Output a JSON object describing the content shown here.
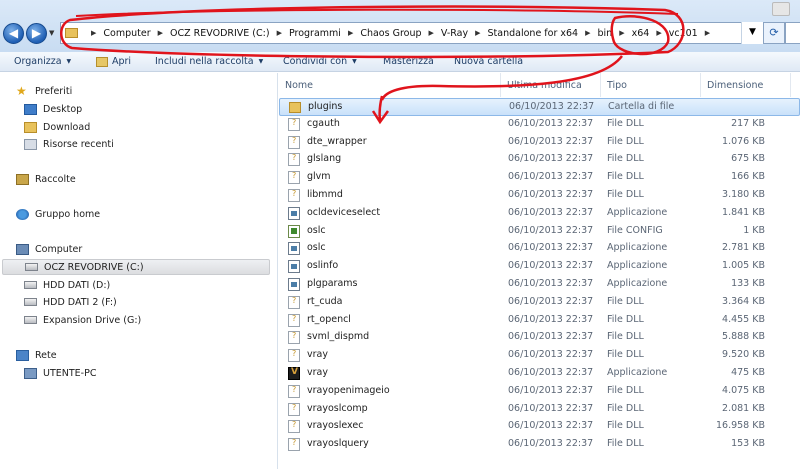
{
  "breadcrumb": [
    "Computer",
    "OCZ REVODRIVE (C:)",
    "Programmi",
    "Chaos Group",
    "V-Ray",
    "Standalone for x64",
    "bin",
    "x64",
    "vc101"
  ],
  "toolbar": {
    "organize": "Organizza",
    "open": "Apri",
    "include": "Includi nella raccolta",
    "share": "Condividi con",
    "burn": "Masterizza",
    "new_folder": "Nuova cartella"
  },
  "nav": {
    "favorites": "Preferiti",
    "desktop": "Desktop",
    "download": "Download",
    "recent": "Risorse recenti",
    "libraries": "Raccolte",
    "homegroup": "Gruppo home",
    "computer": "Computer",
    "drive_c": "OCZ REVODRIVE (C:)",
    "drive_d": "HDD DATI (D:)",
    "drive_f": "HDD DATI 2 (F:)",
    "drive_g": "Expansion Drive (G:)",
    "network": "Rete",
    "pc": "UTENTE-PC"
  },
  "columns": {
    "name": "Nome",
    "modified": "Ultima modifica",
    "type": "Tipo",
    "size": "Dimensione"
  },
  "files": [
    {
      "name": "plugins",
      "date": "06/10/2013 22:37",
      "type": "Cartella di file",
      "size": "",
      "icon": "folder-icon"
    },
    {
      "name": "cgauth",
      "date": "06/10/2013 22:37",
      "type": "File DLL",
      "size": "217 KB",
      "icon": "dll-icon"
    },
    {
      "name": "dte_wrapper",
      "date": "06/10/2013 22:37",
      "type": "File DLL",
      "size": "1.076 KB",
      "icon": "dll-icon"
    },
    {
      "name": "glslang",
      "date": "06/10/2013 22:37",
      "type": "File DLL",
      "size": "675 KB",
      "icon": "dll-icon"
    },
    {
      "name": "glvm",
      "date": "06/10/2013 22:37",
      "type": "File DLL",
      "size": "166 KB",
      "icon": "dll-icon"
    },
    {
      "name": "libmmd",
      "date": "06/10/2013 22:37",
      "type": "File DLL",
      "size": "3.180 KB",
      "icon": "dll-icon"
    },
    {
      "name": "ocldeviceselect",
      "date": "06/10/2013 22:37",
      "type": "Applicazione",
      "size": "1.841 KB",
      "icon": "app-icon"
    },
    {
      "name": "oslc",
      "date": "06/10/2013 22:37",
      "type": "File CONFIG",
      "size": "1 KB",
      "icon": "config-icon"
    },
    {
      "name": "oslc",
      "date": "06/10/2013 22:37",
      "type": "Applicazione",
      "size": "2.781 KB",
      "icon": "app-icon"
    },
    {
      "name": "oslinfo",
      "date": "06/10/2013 22:37",
      "type": "Applicazione",
      "size": "1.005 KB",
      "icon": "app-icon"
    },
    {
      "name": "plgparams",
      "date": "06/10/2013 22:37",
      "type": "Applicazione",
      "size": "133 KB",
      "icon": "app-icon"
    },
    {
      "name": "rt_cuda",
      "date": "06/10/2013 22:37",
      "type": "File DLL",
      "size": "3.364 KB",
      "icon": "dll-icon"
    },
    {
      "name": "rt_opencl",
      "date": "06/10/2013 22:37",
      "type": "File DLL",
      "size": "4.455 KB",
      "icon": "dll-icon"
    },
    {
      "name": "svml_dispmd",
      "date": "06/10/2013 22:37",
      "type": "File DLL",
      "size": "5.888 KB",
      "icon": "dll-icon"
    },
    {
      "name": "vray",
      "date": "06/10/2013 22:37",
      "type": "File DLL",
      "size": "9.520 KB",
      "icon": "dll-icon"
    },
    {
      "name": "vray",
      "date": "06/10/2013 22:37",
      "type": "Applicazione",
      "size": "475 KB",
      "icon": "vray-icon"
    },
    {
      "name": "vrayopenimageio",
      "date": "06/10/2013 22:37",
      "type": "File DLL",
      "size": "4.075 KB",
      "icon": "dll-icon"
    },
    {
      "name": "vrayoslcomp",
      "date": "06/10/2013 22:37",
      "type": "File DLL",
      "size": "2.081 KB",
      "icon": "dll-icon"
    },
    {
      "name": "vrayoslexec",
      "date": "06/10/2013 22:37",
      "type": "File DLL",
      "size": "16.958 KB",
      "icon": "dll-icon"
    },
    {
      "name": "vrayoslquery",
      "date": "06/10/2013 22:37",
      "type": "File DLL",
      "size": "153 KB",
      "icon": "dll-icon"
    }
  ],
  "colors": {
    "annotation": "#e0141c",
    "selection": "#c9e1fa"
  }
}
